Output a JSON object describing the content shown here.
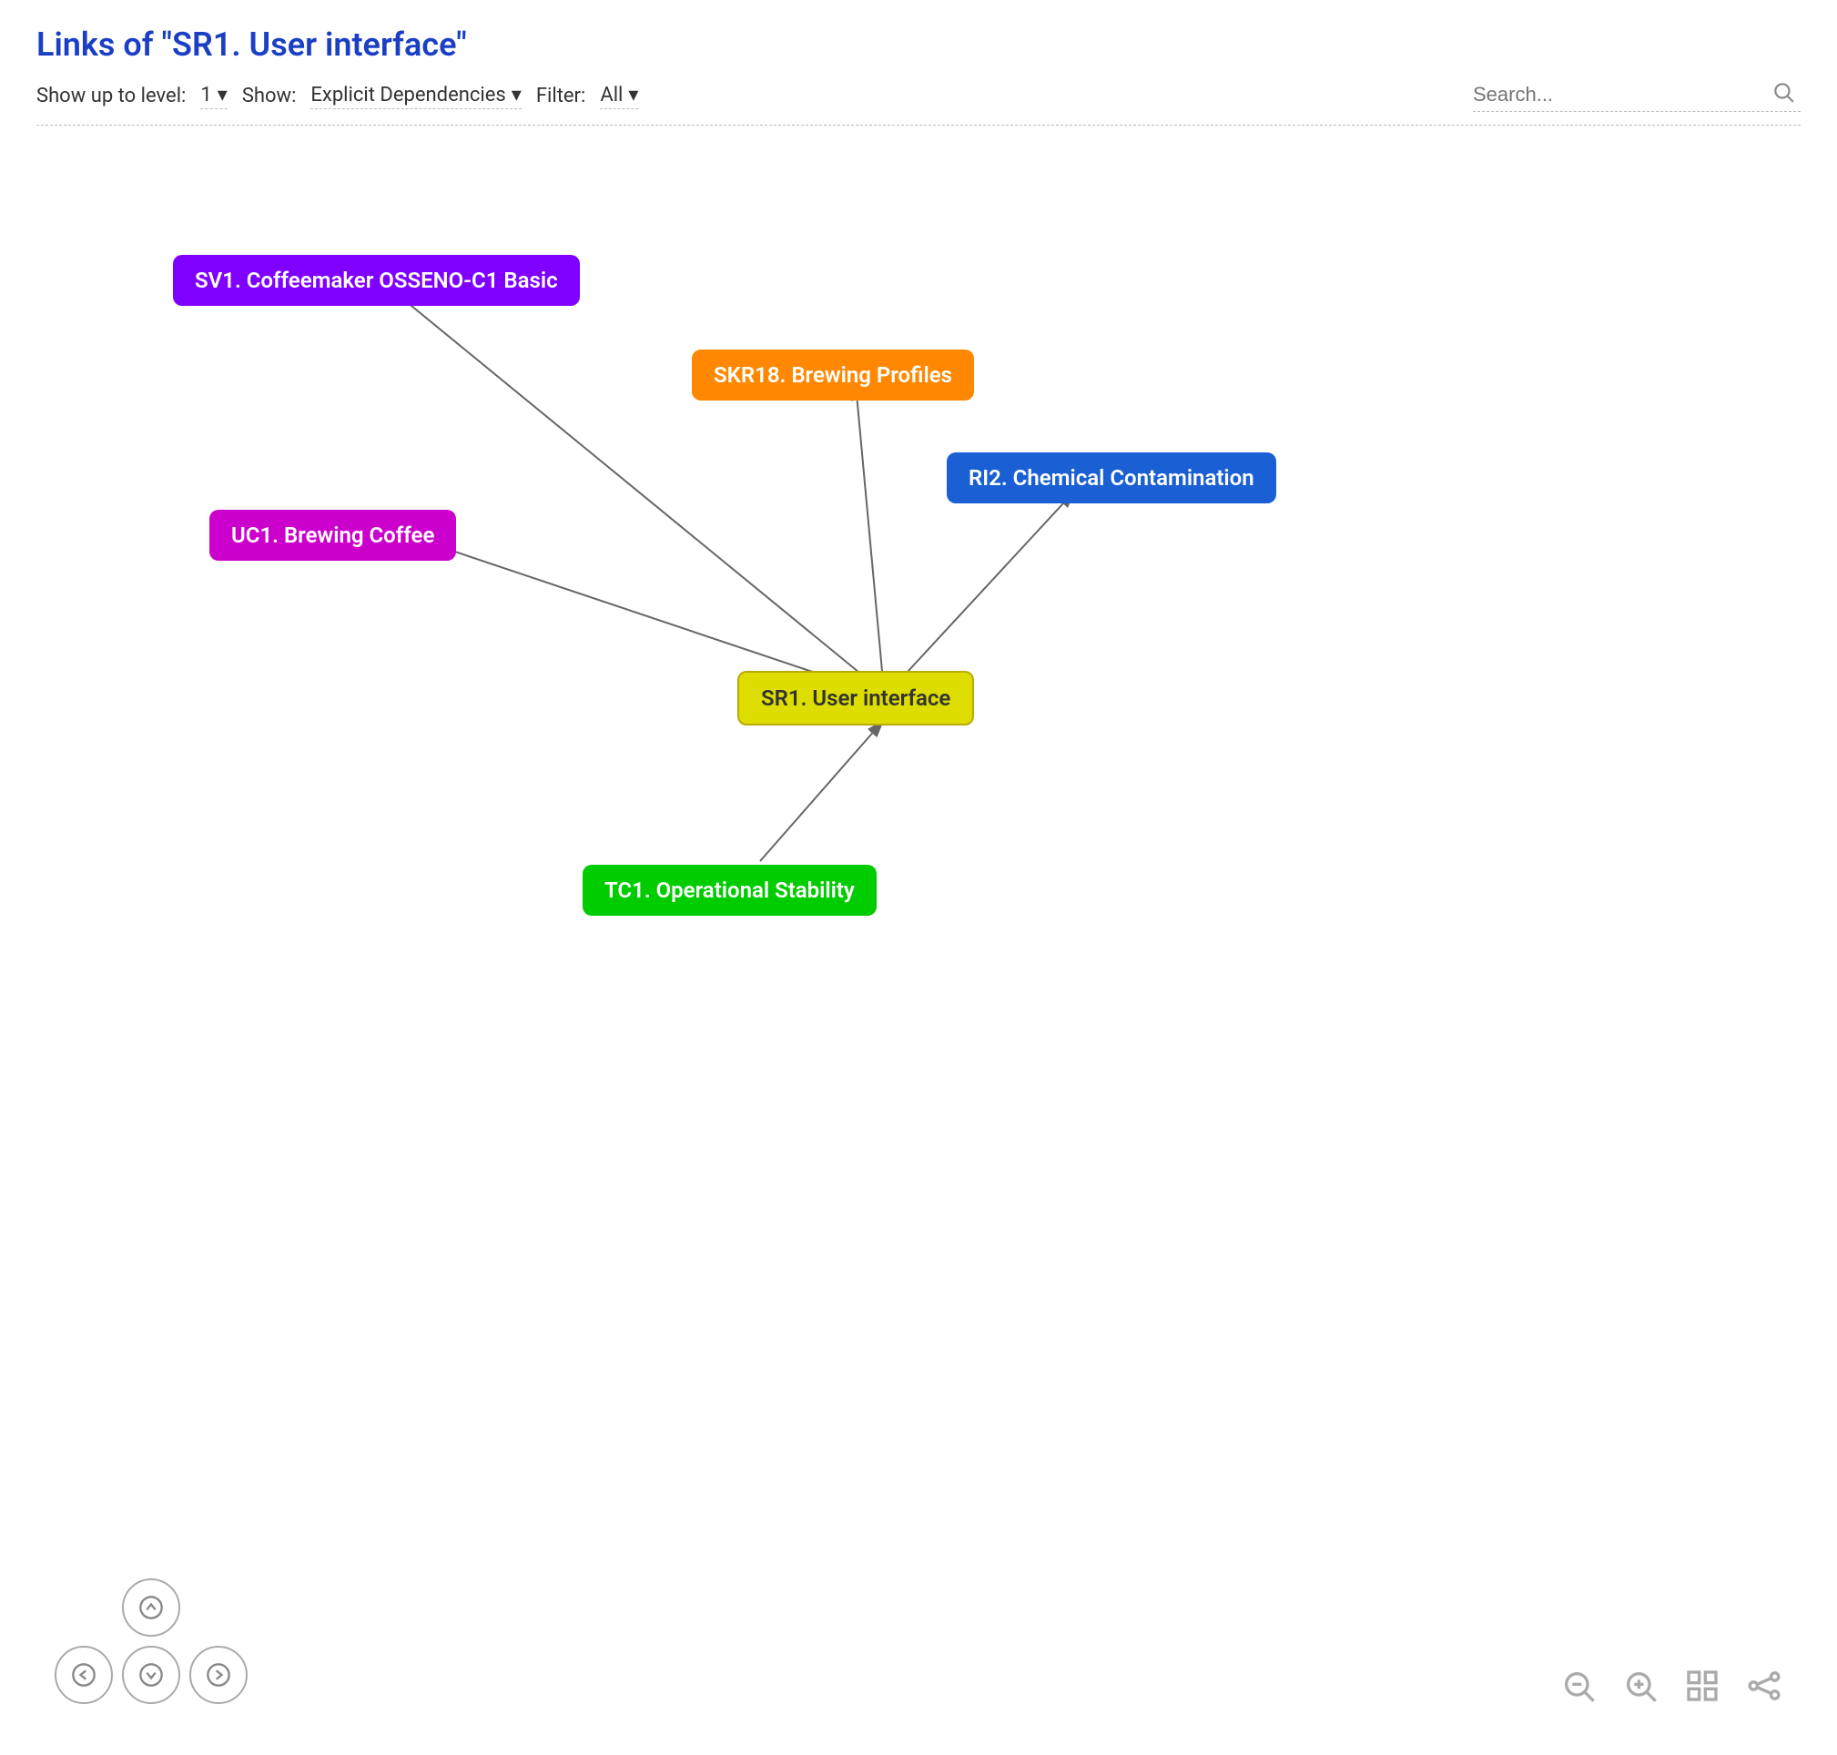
{
  "header": {
    "title": "Links of \"SR1. User interface\""
  },
  "toolbar": {
    "show_up_to_level_label": "Show up to level:",
    "level_value": "1",
    "show_label": "Show:",
    "show_value": "Explicit Dependencies",
    "filter_label": "Filter:",
    "filter_value": "All"
  },
  "search": {
    "placeholder": "Search..."
  },
  "nodes": {
    "sv1": {
      "label": "SV1. Coffeemaker OSSENO-C1 Basic"
    },
    "skr18": {
      "label": "SKR18. Brewing Profiles"
    },
    "ri2": {
      "label": "RI2. Chemical Contamination"
    },
    "uc1": {
      "label": "UC1. Brewing Coffee"
    },
    "sr1": {
      "label": "SR1. User interface"
    },
    "tc1": {
      "label": "TC1. Operational Stability"
    }
  },
  "nav": {
    "up": "↑",
    "down": "↓",
    "left": "←",
    "right": "→"
  },
  "zoom": {
    "zoom_out": "−",
    "zoom_in": "+"
  },
  "colors": {
    "sv1": "#8000ff",
    "skr18": "#ff8800",
    "ri2": "#1a5fd4",
    "uc1": "#cc00cc",
    "sr1": "#dddd00",
    "tc1": "#00cc00",
    "title": "#1a3fc4"
  }
}
